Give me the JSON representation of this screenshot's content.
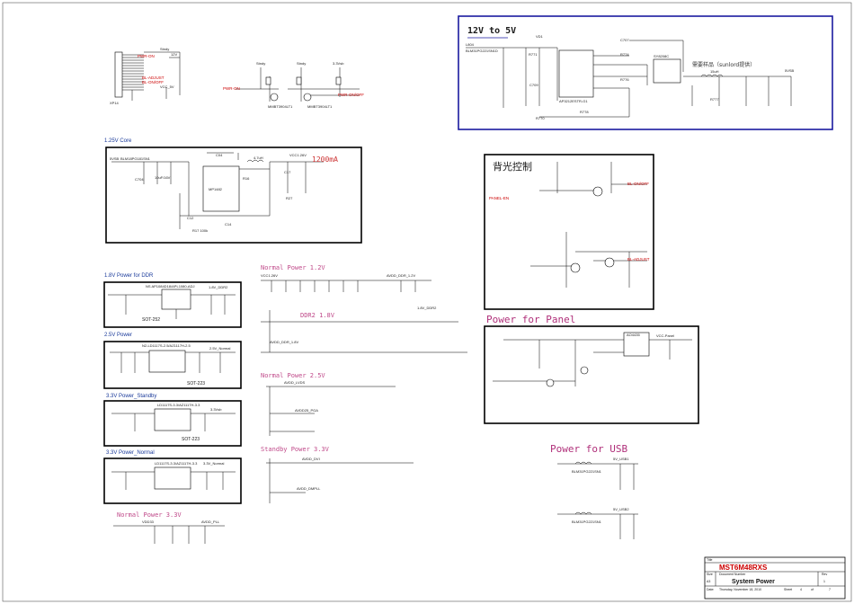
{
  "colors": {
    "wire": "#000000",
    "net": "#cc0000",
    "section": "#b0307a",
    "frame_blue": "#1a1aa0"
  },
  "header": {
    "c1": "PWR-ON",
    "c2": "BL-ADJUST",
    "c3": "BL-ON/OFF",
    "c4": "VCC_5V",
    "c5": "XP14",
    "c6": "Stndy",
    "c7": "12V",
    "c8": "PWR-ON",
    "c9": "PWR-ON/OFF"
  },
  "dcdc": {
    "title": "12V to 5V",
    "l1": "L804",
    "l2": "BLM31PG221SN1D",
    "u": "AP3212ESTR-G1",
    "u2": "SY8208C",
    "u3": "NCP3170",
    "note": "需要样品（sunlord提供）",
    "ind": "15uH",
    "out": "5VSB"
  },
  "core": {
    "title": "1.25V Core",
    "chip": "MP1482",
    "cur": "1200mA",
    "vout": "VCC1.26V",
    "in": "5VSB",
    "l": "4.7uH"
  },
  "ddr": {
    "title": "1.8V Power for DDR",
    "chip": "NS AP1084D18/APL1080-ADJ",
    "pkg": "SOT-252",
    "vout": "1.8V_DDR2"
  },
  "p25": {
    "title": "2.5V Power",
    "chip": "N2-LD1117S-2.5/AZ1117H-2.5",
    "pkg": "SOT-223",
    "vout": "2.5V_Normal"
  },
  "p33s": {
    "title": "3.3V Power_Standby",
    "chip": "LD1117S-3.3/AZ1117H-3.3",
    "pkg": "SOT-223",
    "vout": "3.3Vsb"
  },
  "p33n": {
    "title": "3.3V Power_Normal",
    "chip": "LD1117S-3.3/AZ1117H-3.3",
    "vout": "3.3V_Normal"
  },
  "np33": {
    "title": "Normal Power 3.3V",
    "n1": "AVDD_PLL",
    "n2": "VDD33"
  },
  "np12": {
    "title": "Normal Power 1.2V",
    "n1": "AVDD_DDR_1.2V",
    "n2": "VCC1.26V"
  },
  "ddr2": {
    "title": "DDR2 1.8V",
    "n1": "AVDD_DDR_1.8V",
    "n2": "1.8V_DDR2"
  },
  "np25": {
    "title": "Normal Power 2.5V",
    "n1": "AVDD_LVDS",
    "n2": "AVDD25_PGA"
  },
  "sp33": {
    "title": "Standby Power 3.3V",
    "n1": "AVDD_DVI",
    "n2": "AVDD_DMPLL"
  },
  "bl": {
    "title": "背光控制",
    "n1": "BL-ON/OFF",
    "n2": "BL-ADJUST",
    "n3": "PANEL-EN"
  },
  "panel": {
    "title": "Power for Panel",
    "n1": "VCC-Panel",
    "chip": "AO4435"
  },
  "usb": {
    "title": "Power for USB",
    "n1": "5V_USB1",
    "n2": "5V_USB2",
    "l1": "BLM31PG221SN1",
    "l2": "BLM31PG221SN1"
  },
  "titleblock": {
    "title_label": "Title",
    "title": "MST6M48RXS",
    "doc_label": "Document Number",
    "doc": "System Power",
    "rev_label": "Rev",
    "rev": "1",
    "size_label": "Size",
    "size": "A3",
    "date_label": "Date:",
    "date": "Thursday, November 18, 2010",
    "sheet_label": "Sheet",
    "sheet": "4",
    "of_label": "of",
    "of": "7"
  }
}
